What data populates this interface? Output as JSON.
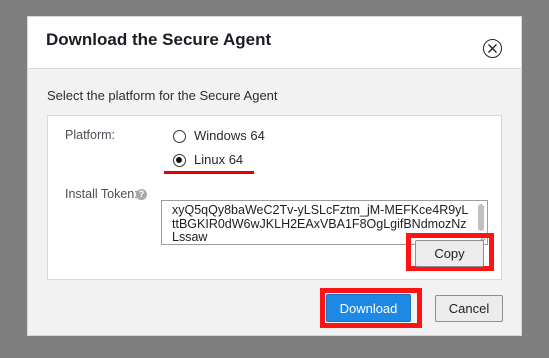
{
  "dialog": {
    "title": "Download the Secure Agent",
    "subtitle": "Select the platform for the Secure Agent"
  },
  "form": {
    "platform_label": "Platform:",
    "platform_options": [
      {
        "label": "Windows 64",
        "selected": false
      },
      {
        "label": "Linux 64",
        "selected": true
      }
    ],
    "token_label": "Install Token:",
    "info_icon_glyph": "?",
    "token_value": "xyQ5qQy8baWeC2Tv-yLSLcFztm_jM-MEFKce4R9yLttBGKIR0dW6wJKLH2EAxVBA1F8OgLgifBNdmozNzLssaw"
  },
  "buttons": {
    "copy": "Copy",
    "download": "Download",
    "cancel": "Cancel"
  },
  "colors": {
    "overlay": "#7f7f7f",
    "accent": "#1e88e5",
    "highlight": "#ff1313"
  },
  "icons": [
    "close-icon",
    "info-icon",
    "resize-handle-icon"
  ]
}
